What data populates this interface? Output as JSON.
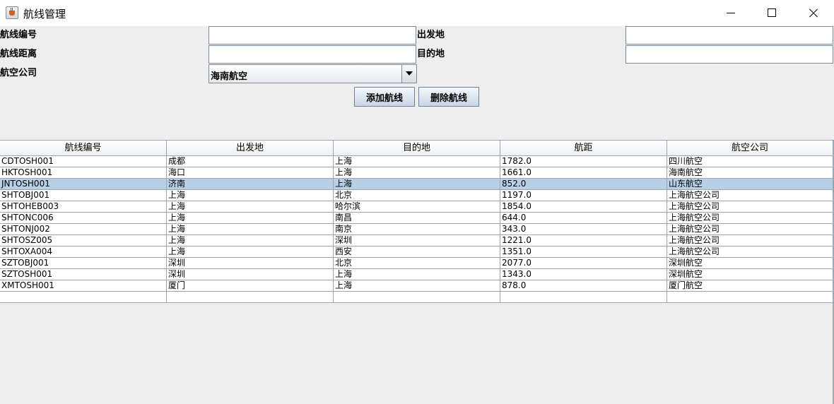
{
  "window": {
    "title": "航线管理"
  },
  "form": {
    "route_no_label": "航线编号",
    "distance_label": "航线距离",
    "airline_label": "航空公司",
    "origin_label": "出发地",
    "destination_label": "目的地",
    "route_no_value": "",
    "distance_value": "",
    "origin_value": "",
    "destination_value": "",
    "airline_selected": "海南航空"
  },
  "buttons": {
    "add": "添加航线",
    "delete": "删除航线"
  },
  "table": {
    "headers": [
      "航线编号",
      "出发地",
      "目的地",
      "航距",
      "航空公司"
    ],
    "rows": [
      [
        "CDTOSH001",
        "成都",
        "上海",
        "1782.0",
        "四川航空"
      ],
      [
        "HKTOSH001",
        "海口",
        "上海",
        "1661.0",
        "海南航空"
      ],
      [
        "JNTOSH001",
        "济南",
        "上海",
        "852.0",
        "山东航空"
      ],
      [
        "SHTOBJ001",
        "上海",
        "北京",
        "1197.0",
        "上海航空公司"
      ],
      [
        "SHTOHEB003",
        "上海",
        "哈尔滨",
        "1854.0",
        "上海航空公司"
      ],
      [
        "SHTONC006",
        "上海",
        "南昌",
        "644.0",
        "上海航空公司"
      ],
      [
        "SHTONJ002",
        "上海",
        "南京",
        "343.0",
        "上海航空公司"
      ],
      [
        "SHTOSZ005",
        "上海",
        "深圳",
        "1221.0",
        "上海航空公司"
      ],
      [
        "SHTOXA004",
        "上海",
        "西安",
        "1351.0",
        "上海航空公司"
      ],
      [
        "SZTOBJ001",
        "深圳",
        "北京",
        "2077.0",
        "深圳航空"
      ],
      [
        "SZTOSH001",
        "深圳",
        "上海",
        "1343.0",
        "深圳航空"
      ],
      [
        "XMTOSH001",
        "厦门",
        "上海",
        "878.0",
        "厦门航空"
      ],
      [
        "",
        "",
        "",
        "",
        ""
      ]
    ],
    "selected_row": 2
  },
  "colors": {
    "selected_row": "#b8cfe5",
    "grid": "#9aa6b3"
  }
}
